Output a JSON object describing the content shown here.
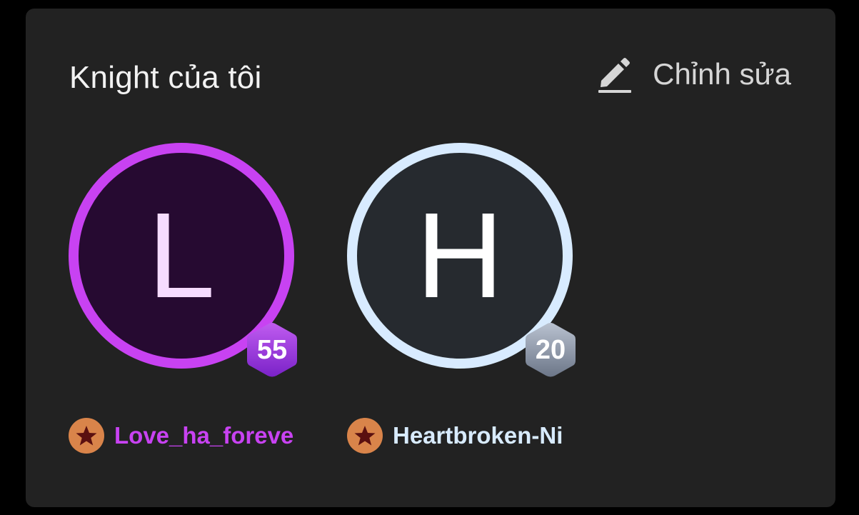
{
  "section": {
    "title": "Knight của tôi",
    "edit_label": "Chỉnh sửa",
    "edit_icon": "pencil-icon"
  },
  "knights": [
    {
      "initial": "L",
      "level": "55",
      "name": "Love_ha_foreve",
      "rank_icon": "star-icon",
      "ring_color": "#c842f2",
      "avatar_bg": "#260a31",
      "name_color": "#c842f2",
      "badge_color": "#9b3ee0"
    },
    {
      "initial": "H",
      "level": "20",
      "name": "Heartbroken-Ni",
      "rank_icon": "star-icon",
      "ring_color": "#d8ebff",
      "avatar_bg": "#262a2f",
      "name_color": "#d8ebff",
      "badge_color": "#8e98a8"
    }
  ]
}
